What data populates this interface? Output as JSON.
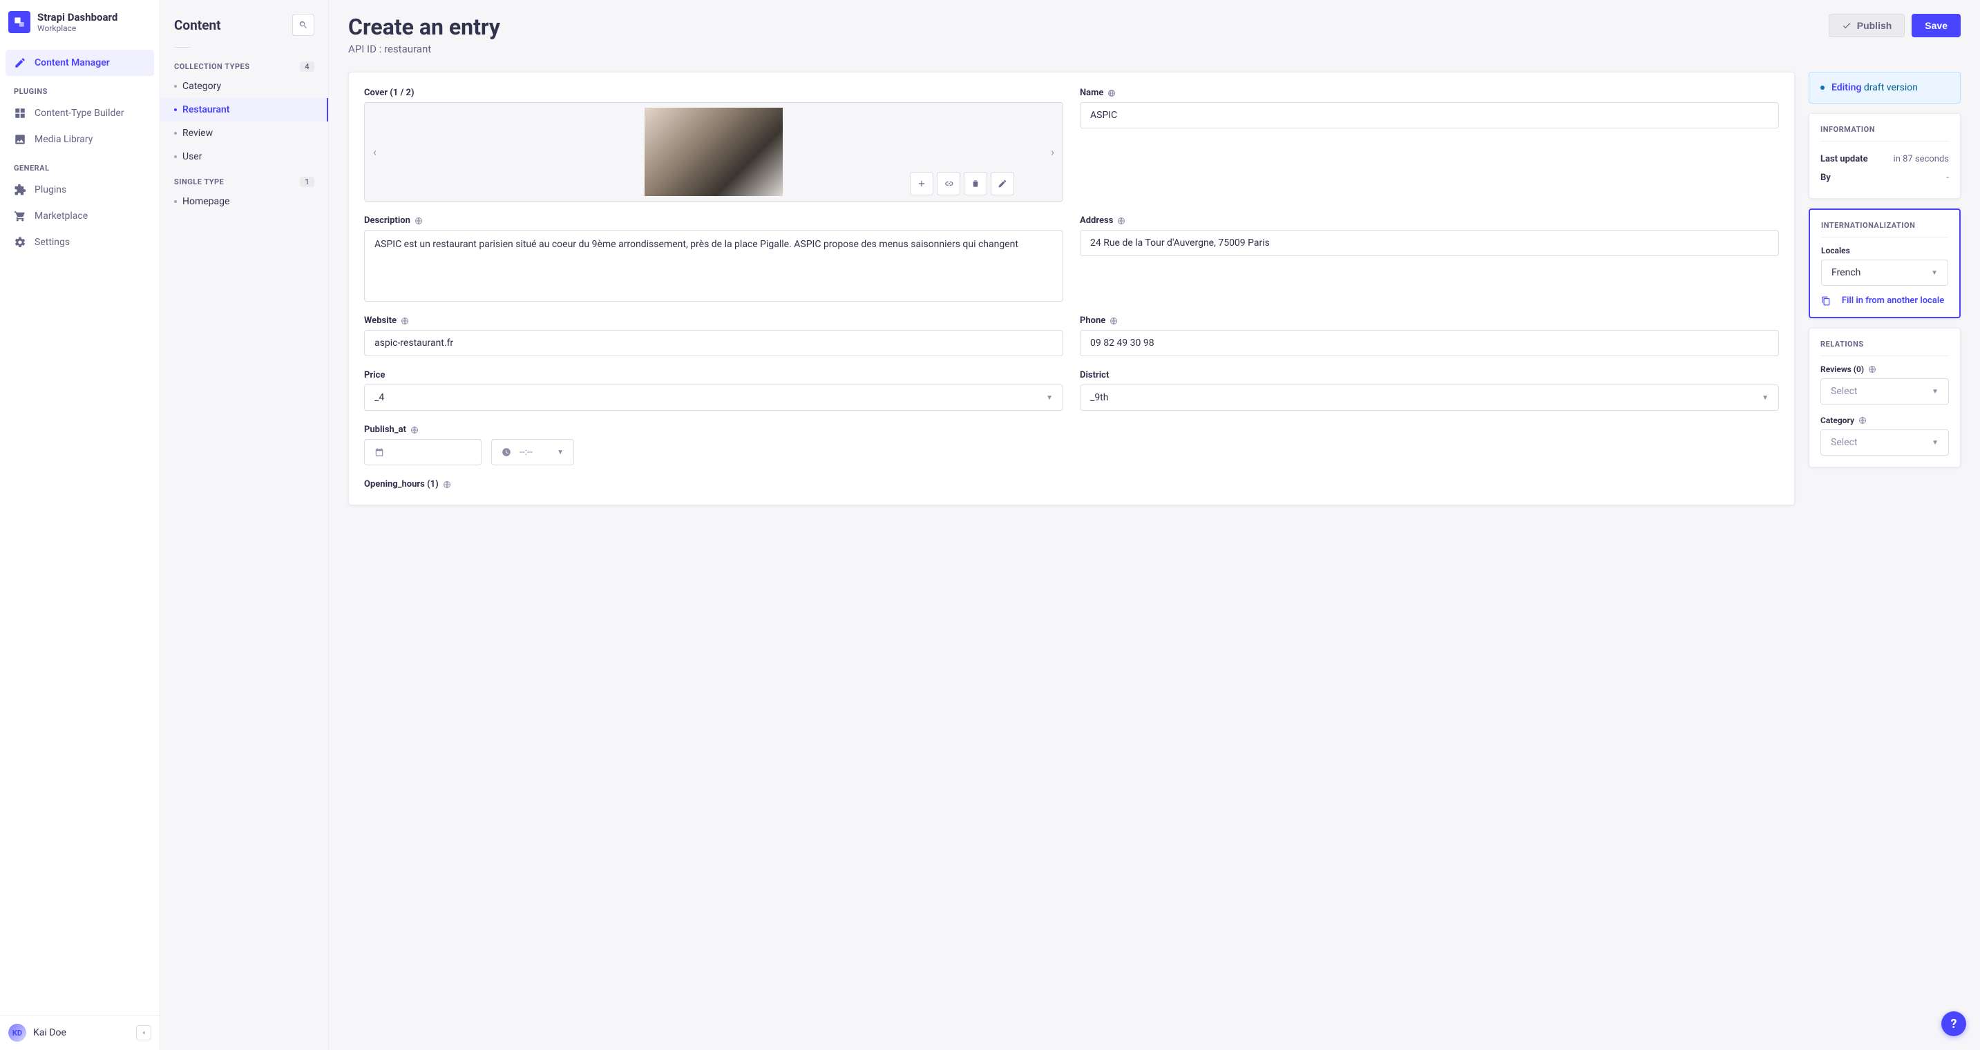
{
  "brand": {
    "title": "Strapi Dashboard",
    "subtitle": "Workplace"
  },
  "nav": {
    "content_manager": "Content Manager",
    "plugins_section": "PLUGINS",
    "ctb": "Content-Type Builder",
    "media": "Media Library",
    "general_section": "GENERAL",
    "plugins": "Plugins",
    "marketplace": "Marketplace",
    "settings": "Settings"
  },
  "user": {
    "initials": "KD",
    "name": "Kai Doe"
  },
  "content_panel": {
    "title": "Content",
    "collection_label": "COLLECTION TYPES",
    "collection_count": "4",
    "items": [
      "Category",
      "Restaurant",
      "Review",
      "User"
    ],
    "single_label": "SINGLE TYPE",
    "single_count": "1",
    "single_items": [
      "Homepage"
    ]
  },
  "page": {
    "title": "Create an entry",
    "subtitle": "API ID : restaurant",
    "publish": "Publish",
    "save": "Save"
  },
  "form": {
    "cover_label": "Cover (1 / 2)",
    "name_label": "Name",
    "name_value": "ASPIC",
    "description_label": "Description",
    "description_value": "ASPIC est un restaurant parisien situé au coeur du 9ème arrondissement, près de la place Pigalle. ASPIC propose des menus saisonniers qui changent",
    "address_label": "Address",
    "address_value": "24 Rue de la Tour d'Auvergne, 75009 Paris",
    "website_label": "Website",
    "website_value": "aspic-restaurant.fr",
    "phone_label": "Phone",
    "phone_value": "09 82 49 30 98",
    "price_label": "Price",
    "price_value": "_4",
    "district_label": "District",
    "district_value": "_9th",
    "publish_at_label": "Publish_at",
    "time_placeholder": "--:--",
    "opening_hours_label": "Opening_hours (1)"
  },
  "status": {
    "prefix": "Editing",
    "suffix": " draft version"
  },
  "info_panel": {
    "title": "INFORMATION",
    "last_update_label": "Last update",
    "last_update_value": "in 87 seconds",
    "by_label": "By",
    "by_value": "-"
  },
  "i18n_panel": {
    "title": "INTERNATIONALIZATION",
    "locales_label": "Locales",
    "locale_value": "French",
    "fill_link": "Fill in from another locale"
  },
  "relations_panel": {
    "title": "RELATIONS",
    "reviews_label": "Reviews (0)",
    "category_label": "Category",
    "select_placeholder": "Select"
  }
}
